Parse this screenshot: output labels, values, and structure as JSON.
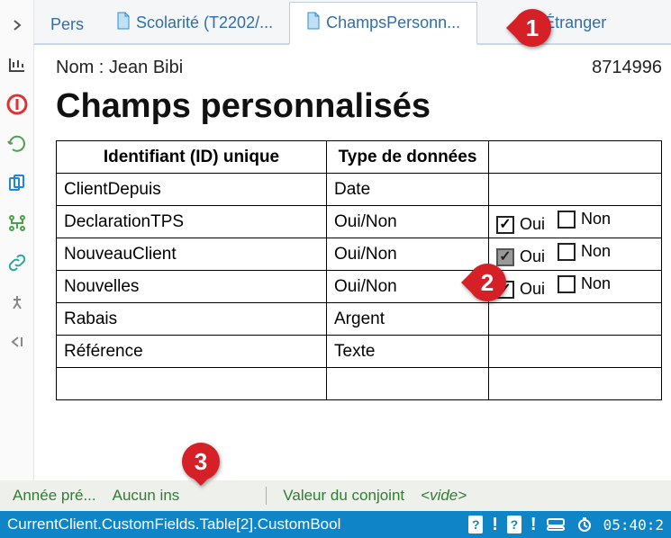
{
  "tabs": {
    "pers": "Pers",
    "scolarite": "Scolarité (T2202/...",
    "champs": "ChampsPersonn...",
    "etranger": "Étranger"
  },
  "header": {
    "nom_label": "Nom : Jean Bibi",
    "id": "8714996"
  },
  "page_title": "Champs personnalisés",
  "table": {
    "headers": {
      "id": "Identifiant (ID) unique",
      "type": "Type de données"
    },
    "rows": [
      {
        "id": "ClientDepuis",
        "type": "Date",
        "oui": null,
        "non": null
      },
      {
        "id": "DeclarationTPS",
        "type": "Oui/Non",
        "oui": true,
        "non": false
      },
      {
        "id": "NouveauClient",
        "type": "Oui/Non",
        "oui": "grey",
        "non": false
      },
      {
        "id": "Nouvelles",
        "type": "Oui/Non",
        "oui": true,
        "non": false
      },
      {
        "id": "Rabais",
        "type": "Argent",
        "oui": null,
        "non": null
      },
      {
        "id": "Référence",
        "type": "Texte",
        "oui": null,
        "non": null
      }
    ],
    "labels": {
      "oui": "Oui",
      "non": "Non"
    }
  },
  "footer1": {
    "annee": "Année pré...",
    "instalment": "Aucun ins",
    "conjoint": "Valeur du conjoint",
    "vide": "<vide>"
  },
  "footer2": {
    "path": "CurrentClient.CustomFields.Table[2].CustomBool",
    "time": "05:40:2"
  },
  "callouts": {
    "c1": "1",
    "c2": "2",
    "c3": "3"
  }
}
